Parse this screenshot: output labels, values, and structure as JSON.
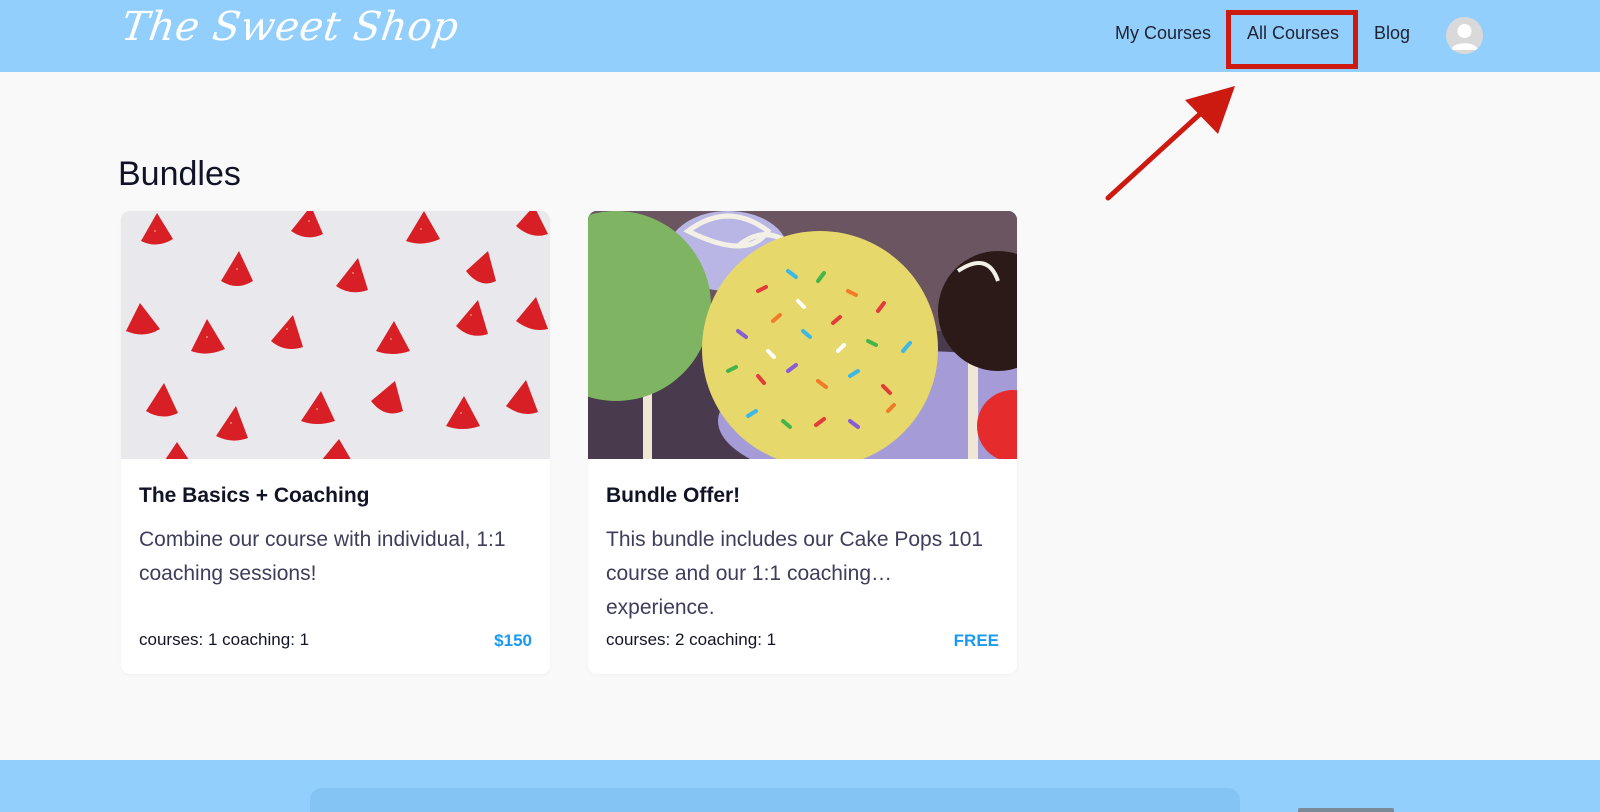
{
  "header": {
    "logo_text": "The Sweet Shop",
    "nav": {
      "my_courses": "My Courses",
      "all_courses": "All Courses",
      "blog": "Blog"
    },
    "background_color": "#92cffd"
  },
  "annotation": {
    "highlight_color": "#cc1a10",
    "highlighted_item": "All Courses"
  },
  "main": {
    "section_title": "Bundles",
    "bundles": [
      {
        "image": "strawberries-photo",
        "title": "The Basics + Coaching",
        "description": "Combine our course with individual, 1:1 coaching sessions!",
        "meta": "courses: 1 coaching: 1",
        "price": "$150"
      },
      {
        "image": "cake-pops-photo",
        "title": "Bundle Offer!",
        "description": "This bundle includes our Cake Pops 101 course and our 1:1 coaching… experience.",
        "meta": "courses: 2 coaching: 1",
        "price": "FREE"
      }
    ]
  },
  "colors": {
    "accent": "#1a9bf0",
    "page_background": "#f9f9f9"
  }
}
